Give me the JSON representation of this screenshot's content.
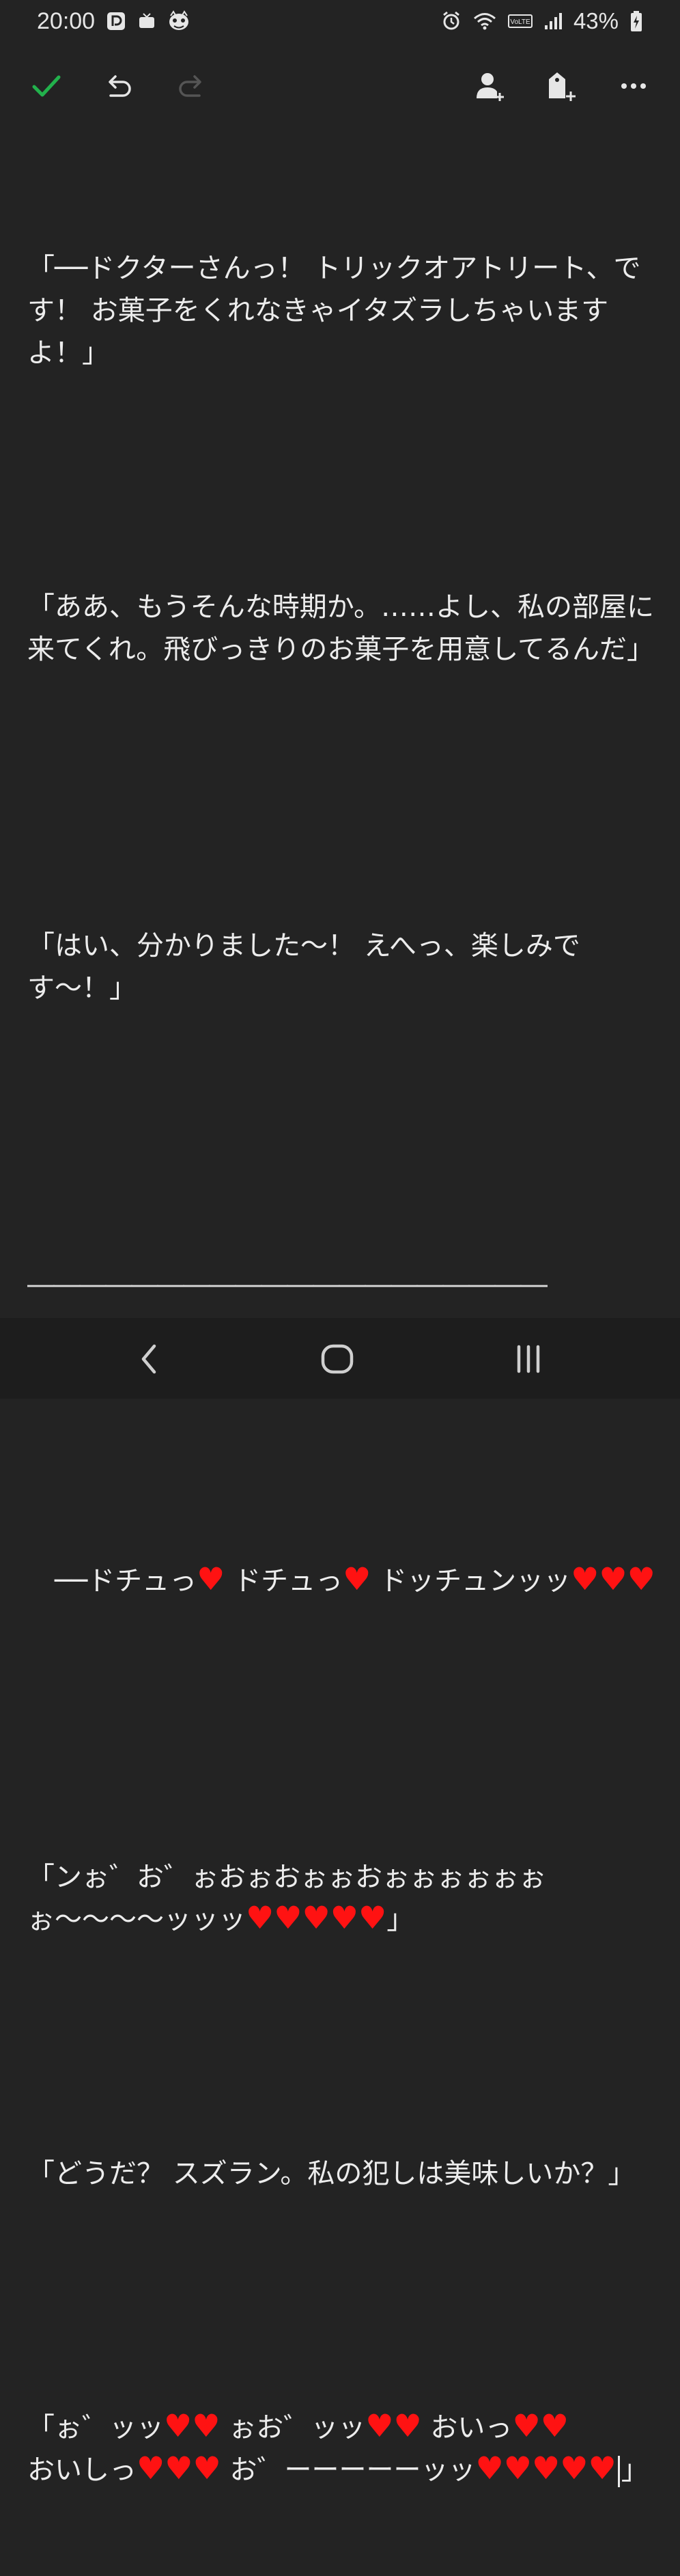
{
  "status_bar": {
    "time": "20:00",
    "battery_percent": "43%",
    "left_icons": [
      "pixiv-icon",
      "tv-icon",
      "game-mascot-icon"
    ],
    "right_icons": [
      "alarm-icon",
      "wifi-icon",
      "volte-icon",
      "signal-icon",
      "battery-charging-icon"
    ],
    "volte_label": "VoLTE"
  },
  "toolbar": {
    "buttons": [
      {
        "name": "confirm-button",
        "icon": "check-icon",
        "color": "#22b14c"
      },
      {
        "name": "undo-button",
        "icon": "undo-icon"
      },
      {
        "name": "redo-button",
        "icon": "redo-icon",
        "disabled": true
      },
      {
        "name": "add-person-button",
        "icon": "add-person-icon"
      },
      {
        "name": "add-tag-button",
        "icon": "add-tag-icon"
      },
      {
        "name": "more-options-button",
        "icon": "more-horizontal-icon"
      }
    ]
  },
  "content": {
    "p1": "「──ドクターさんっ！ トリックオアトリート、です！ お菓子をくれなきゃイタズラしちゃいますよ！」",
    "p2": "「ああ、もうそんな時期か。……よし、私の部屋に来てくれ。飛びっきりのお菓子を用意してるんだ」",
    "p3": "「はい、分かりました〜！ えへっ、楽しみです〜！」",
    "separator": "――――――――――――――――――――",
    "p4_a": "　──ドチュっ",
    "p4_b": " ドチュっ",
    "p4_c": " ドッチュンッッ",
    "p5_a": "「ンぉ゛お゛ぉおぉおぉぉおぉぉぉぉぉぉぉ〜〜〜〜ッッッ",
    "p5_end": "」",
    "p6": "「どうだ？ スズラン。私の犯しは美味しいか？」",
    "p7_a": "「ぉ゛ッッ",
    "p7_b": " ぉお゛ッッ",
    "p7_c": " おいっ",
    "p7_d": "おいしっ",
    "p7_e": " お゛ーーーーーッッ",
    "p7_end": "」",
    "heart": "♥",
    "heart_color": "#ff1212"
  },
  "nav_bar": {
    "buttons": [
      "back-icon",
      "home-icon",
      "recents-icon"
    ]
  }
}
